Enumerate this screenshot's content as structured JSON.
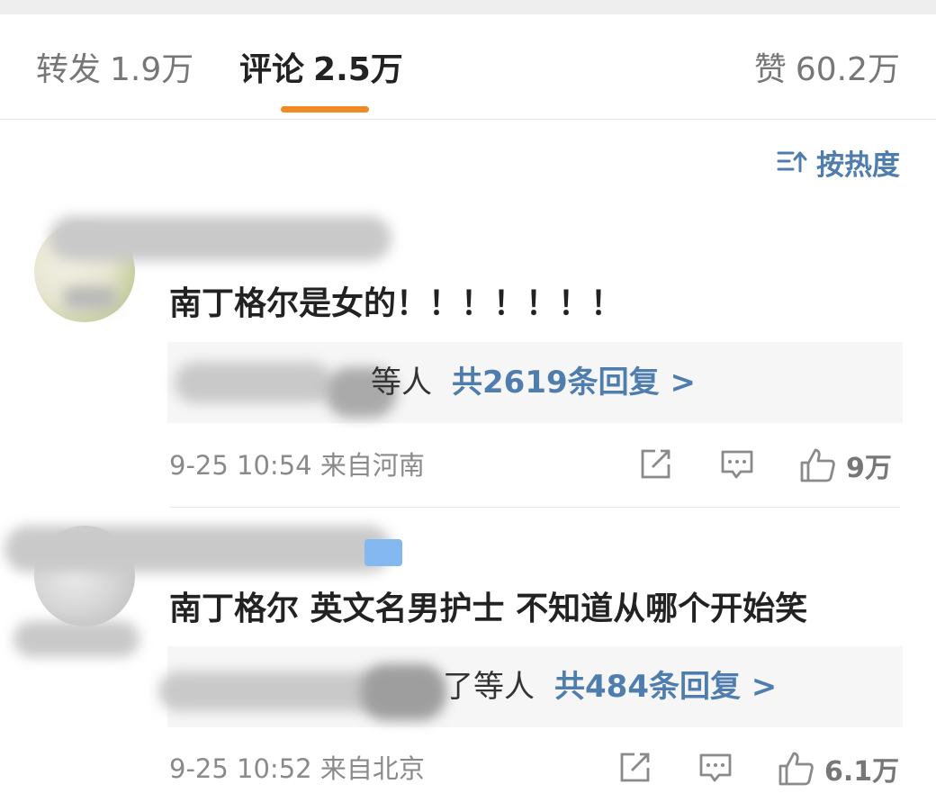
{
  "tabs": {
    "repost": {
      "label": "转发",
      "count": "1.9万"
    },
    "comments": {
      "label": "评论",
      "count": "2.5万"
    },
    "likes": {
      "label": "赞",
      "count": "60.2万"
    }
  },
  "sort": {
    "label": "按热度",
    "icon": "sort-icon"
  },
  "comments": [
    {
      "text": "南丁格尔是女的！！！！！！！",
      "reply_users": "等人",
      "reply_count": "共2619条回复 >",
      "meta": "9-25 10:54 来自河南",
      "likes": "9万"
    },
    {
      "text": "南丁格尔 英文名男护士 不知道从哪个开始笑",
      "reply_users": "了等人",
      "reply_count": "共484条回复 >",
      "meta": "9-25 10:52 来自北京",
      "likes": "6.1万"
    }
  ],
  "colors": {
    "accent": "#f08a24",
    "link": "#4f7dad"
  }
}
